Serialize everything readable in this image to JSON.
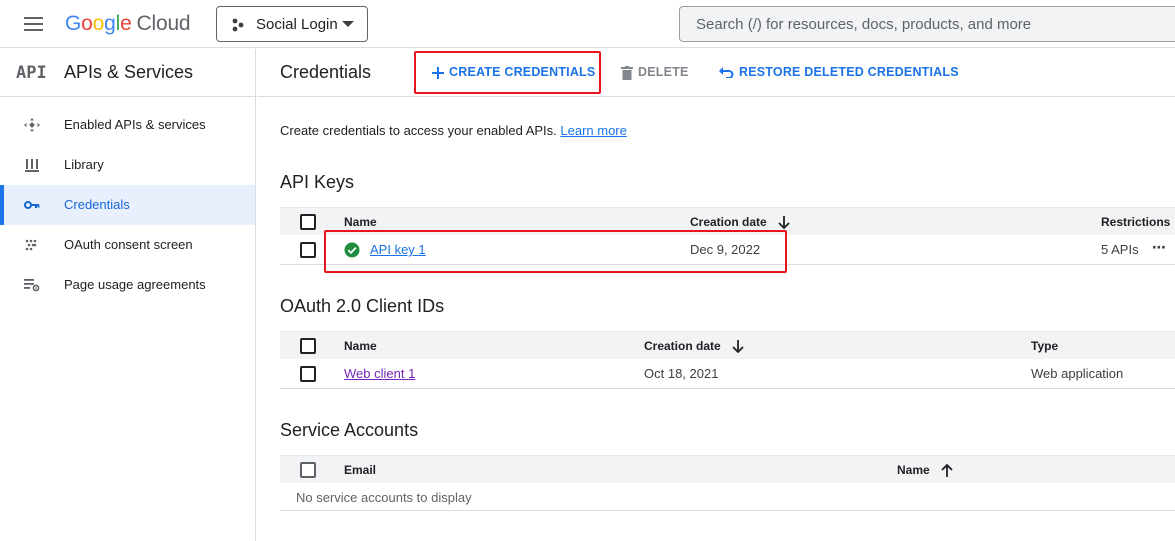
{
  "topbar": {
    "logo_google": "Google",
    "logo_cloud": "Cloud",
    "project_name": "Social Login",
    "search_placeholder": "Search (/) for resources, docs, products, and more"
  },
  "sidebar": {
    "brand": "API",
    "title": "APIs & Services",
    "items": [
      {
        "label": "Enabled APIs & services",
        "icon": "api-hub-icon"
      },
      {
        "label": "Library",
        "icon": "library-icon"
      },
      {
        "label": "Credentials",
        "icon": "key-icon",
        "active": true
      },
      {
        "label": "OAuth consent screen",
        "icon": "oauth-icon"
      },
      {
        "label": "Page usage agreements",
        "icon": "settings-list-icon"
      }
    ]
  },
  "main": {
    "title": "Credentials",
    "actions": {
      "create": "CREATE CREDENTIALS",
      "delete": "DELETE",
      "restore": "RESTORE DELETED CREDENTIALS"
    },
    "intro_text": "Create credentials to access your enabled APIs.",
    "learn_more": "Learn more",
    "api_keys": {
      "title": "API Keys",
      "headers": {
        "name": "Name",
        "creation_date": "Creation date",
        "restrictions": "Restrictions"
      },
      "rows": [
        {
          "name": "API key 1",
          "creation_date": "Dec 9, 2022",
          "restrictions": "5 APIs",
          "menu": "⋯"
        }
      ]
    },
    "oauth": {
      "title": "OAuth 2.0 Client IDs",
      "headers": {
        "name": "Name",
        "creation_date": "Creation date",
        "type": "Type"
      },
      "rows": [
        {
          "name": "Web client 1",
          "creation_date": "Oct 18, 2021",
          "type": "Web application"
        }
      ]
    },
    "service_accounts": {
      "title": "Service Accounts",
      "headers": {
        "email": "Email",
        "name": "Name"
      },
      "empty": "No service accounts to display"
    }
  },
  "colors": {
    "accent": "#1a73e8",
    "highlight": "#e8141b",
    "status_ok": "#1e8e3e",
    "visited_link": "#7627bb"
  }
}
